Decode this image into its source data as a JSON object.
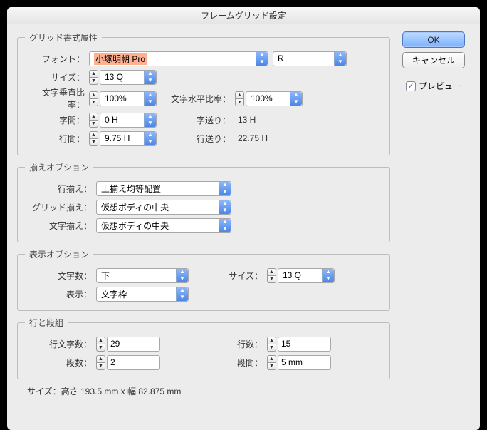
{
  "title": "フレームグリッド設定",
  "groups": {
    "grid": {
      "legend": "グリッド書式属性",
      "font_label": "フォント",
      "font_family": "小塚明朝 Pro",
      "font_style": "R",
      "size_label": "サイズ",
      "size": "13 Q",
      "vscale_label": "文字垂直比率",
      "vscale": "100%",
      "hscale_label": "文字水平比率",
      "hscale": "100%",
      "char_aki_label": "字間",
      "char_aki": "0 H",
      "char_okuri_label": "字送り",
      "char_okuri": "13 H",
      "line_aki_label": "行間",
      "line_aki": "9.75 H",
      "line_okuri_label": "行送り",
      "line_okuri": "22.75 H"
    },
    "align": {
      "legend": "揃えオプション",
      "line_align_label": "行揃え",
      "line_align": "上揃え均等配置",
      "grid_align_label": "グリッド揃え",
      "grid_align": "仮想ボディの中央",
      "char_align_label": "文字揃え",
      "char_align": "仮想ボディの中央"
    },
    "view": {
      "legend": "表示オプション",
      "charcount_label": "文字数",
      "charcount": "下",
      "size_label": "サイズ",
      "size": "13 Q",
      "view_label": "表示",
      "view": "文字枠"
    },
    "cols": {
      "legend": "行と段組",
      "chars_label": "行文字数",
      "chars": "29",
      "lines_label": "行数",
      "lines": "15",
      "dan_label": "段数",
      "dan": "2",
      "gap_label": "段間",
      "gap": "5 mm"
    }
  },
  "footer": "サイズ：高さ 193.5 mm x 幅 82.875 mm",
  "buttons": {
    "ok": "OK",
    "cancel": "キャンセル"
  },
  "preview_label": "プレビュー",
  "preview_checked": true
}
